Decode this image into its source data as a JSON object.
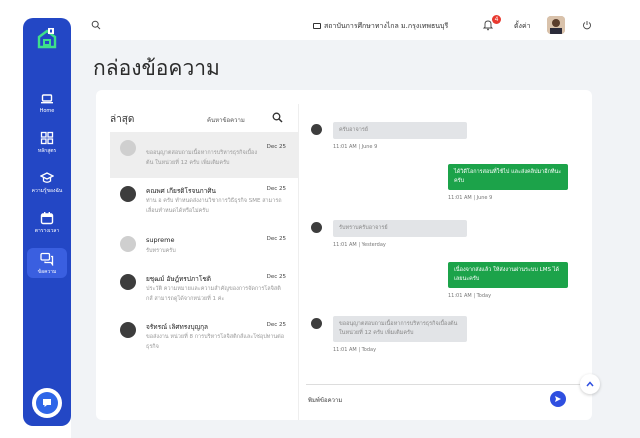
{
  "sidebar": {
    "items": [
      {
        "label": "Home",
        "icon": "laptop-icon"
      },
      {
        "label": "หลักสูตร",
        "icon": "grid-icon"
      },
      {
        "label": "ความรู้ของฉัน",
        "icon": "graduation-cap-icon"
      },
      {
        "label": "ตารางเวลา",
        "icon": "calendar-icon"
      },
      {
        "label": "ข้อความ",
        "icon": "chat-icon",
        "active": true
      }
    ]
  },
  "topbar": {
    "org_name": "สถาบันการศึกษาทางไกล ม.กรุงเทพธนบุรี",
    "notification_count": "4",
    "settings_label": "ตั้งค่า"
  },
  "page": {
    "title": "กล่องข้อความ"
  },
  "inbox": {
    "title": "ล่าสุด",
    "search_label": "ค้นหาข้อความ",
    "conversations": [
      {
        "name": "",
        "date": "Dec 25",
        "preview": "ขออนุญาตสอบถามเนื้อหาการบริหารธุรกิจเบื้องต้น ในหน่วยที่ 12 ครับ เพิ่มเติมครับ",
        "avatar": "grey",
        "selected": true
      },
      {
        "name": "คณพศ เกียรติโรจนกาศิน",
        "date": "Dec 25",
        "preview": "ท่าน อ ครับ ทำหนดส่งงานวิชาการวิธีธุรกิจ SME สามารถเลื่อนทำหนดได้หรือไม่ครับ",
        "avatar": "photo"
      },
      {
        "name": "supreme",
        "date": "Dec 25",
        "preview": "รับทราบครับ",
        "avatar": "grey"
      },
      {
        "name": "ยชุฒม์ อัษฎ์ทรปภาโชติ",
        "date": "Dec 25",
        "preview": "ประวัติ ความหมายและความสำคัญของการจัดการโลจิสติกส์ สามารถดูได้จากหน่วยที่ 1 ค่ะ",
        "avatar": "photo"
      },
      {
        "name": "จรัทรณ์ เลิศทรงบุญกุล",
        "date": "Dec 25",
        "preview": "ขอส่งงาน หน่วยที่ 8 การบริหารโลจิสติกส์และโซ่อุปทานต่อธุรกิจ",
        "avatar": "photo"
      }
    ]
  },
  "messages": [
    {
      "side": "in",
      "text": "ครับอาจารย์",
      "time": "11:01 AM | June 9"
    },
    {
      "side": "out",
      "text": "ได้วิดีโอการสอนที่ใช้ไป และส่งคลิปมาอีกทีนะครับ",
      "time": "11:01 AM | June 9"
    },
    {
      "side": "in",
      "text": "รับทราบครับอาจารย์",
      "time": "11:01 AM | Yesterday"
    },
    {
      "side": "out",
      "text": "เนื่องจากส่งแล้ว ให้ส่งงานผ่านระบบ LMS ได้เลยนะครับ",
      "time": "11:01 AM | Today"
    },
    {
      "side": "in",
      "text": "ขออนุญาตสอบถามเนื้อหาการบริหารธุรกิจเบื้องต้น ในหน่วยที่ 12 ครับ เพิ่มเติมครับ",
      "time": "11:01 AM | Today"
    }
  ],
  "composer": {
    "placeholder": "พิมพ์ข้อความ"
  },
  "colors": {
    "sidebar": "#2347c5",
    "outgoing_bubble": "#1ca34a",
    "incoming_bubble": "#e2e4e7",
    "badge": "#e8392f"
  }
}
